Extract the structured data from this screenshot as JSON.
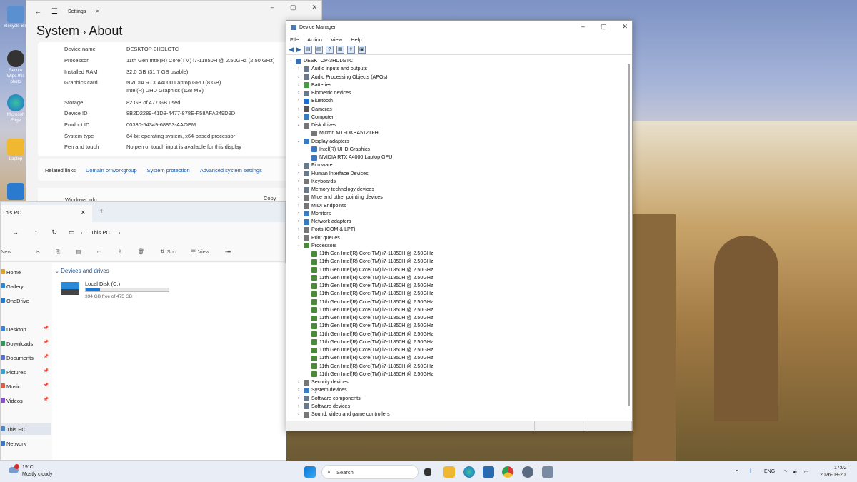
{
  "desktop": {
    "icons": [
      {
        "label": "Recycle Bin",
        "icon": "recycle-bin-icon"
      },
      {
        "label": "Secure Wipe this photo",
        "icon": "secure-wipe-icon"
      },
      {
        "label": "Microsoft Edge",
        "icon": "edge-icon"
      },
      {
        "label": "Laptop",
        "icon": "user-folder-icon"
      },
      {
        "label": "",
        "icon": "monitor-icon"
      }
    ]
  },
  "settings": {
    "title": "Settings",
    "breadcrumb_parent": "System",
    "breadcrumb_sep": "›",
    "breadcrumb_current": "About",
    "specs": [
      {
        "label": "Device name",
        "value": "DESKTOP-3HDLGTC"
      },
      {
        "label": "Processor",
        "value": "11th Gen Intel(R) Core(TM) i7-11850H @ 2.50GHz   (2.50 GHz)"
      },
      {
        "label": "Installed RAM",
        "value": "32.0 GB (31.7 GB usable)"
      },
      {
        "label": "Graphics card",
        "value": "NVIDIA RTX A4000 Laptop GPU (8 GB)"
      },
      {
        "label": "",
        "value": "Intel(R) UHD Graphics (128 MB)"
      },
      {
        "label": "Storage",
        "value": "82 GB of 477 GB used"
      },
      {
        "label": "Device ID",
        "value": "8B2D2289-41D8-4477-878E-F58AFA249D9D"
      },
      {
        "label": "Product ID",
        "value": "00330-54349-68853-AAOEM"
      },
      {
        "label": "System type",
        "value": "64-bit operating system, x64-based processor"
      },
      {
        "label": "Pen and touch",
        "value": "No pen or touch input is available for this display"
      }
    ],
    "related_label": "Related links",
    "related_links": [
      "Domain or workgroup",
      "System protection",
      "Advanced system settings"
    ],
    "windows_info_label": "Windows info",
    "copy_label": "Copy"
  },
  "explorer": {
    "tab_title": "This PC",
    "address": "This PC",
    "cmd": {
      "new": "New",
      "sort": "Sort",
      "view": "View",
      "more": "•••"
    },
    "nav_items": [
      {
        "label": "Home",
        "color": "#e0a030",
        "pinned": false
      },
      {
        "label": "Gallery",
        "color": "#2a8ad8",
        "pinned": false
      },
      {
        "label": "OneDrive",
        "color": "#1e78d2",
        "pinned": false
      },
      {
        "label": "Desktop",
        "color": "#3b82d6",
        "pinned": true
      },
      {
        "label": "Downloads",
        "color": "#2e9a58",
        "pinned": true
      },
      {
        "label": "Documents",
        "color": "#5a6fd0",
        "pinned": true
      },
      {
        "label": "Pictures",
        "color": "#3aa0d8",
        "pinned": true
      },
      {
        "label": "Music",
        "color": "#d8603a",
        "pinned": true
      },
      {
        "label": "Videos",
        "color": "#8a4cd0",
        "pinned": true
      },
      {
        "label": "This PC",
        "color": "#4a86c8",
        "pinned": false
      },
      {
        "label": "Network",
        "color": "#3a7ac0",
        "pinned": false
      }
    ],
    "section_title": "Devices and drives",
    "drive": {
      "name": "Local Disk (C:)",
      "free_text": "394 GB free of 475 GB",
      "used_fraction": 0.17
    }
  },
  "devmgr": {
    "title": "Device Manager",
    "menu": [
      "File",
      "Action",
      "View",
      "Help"
    ],
    "tree": [
      {
        "label": "DESKTOP-3HDLGTC",
        "depth": 0,
        "tw": "v",
        "color": "#3a6fb0"
      },
      {
        "label": "Audio inputs and outputs",
        "depth": 1,
        "tw": ">",
        "color": "#6a7a8a"
      },
      {
        "label": "Audio Processing Objects (APOs)",
        "depth": 1,
        "tw": ">",
        "color": "#6a7a8a"
      },
      {
        "label": "Batteries",
        "depth": 1,
        "tw": ">",
        "color": "#4a9a4a"
      },
      {
        "label": "Biometric devices",
        "depth": 1,
        "tw": ">",
        "color": "#6a7a8a"
      },
      {
        "label": "Bluetooth",
        "depth": 1,
        "tw": ">",
        "color": "#1e6fd0"
      },
      {
        "label": "Cameras",
        "depth": 1,
        "tw": ">",
        "color": "#555"
      },
      {
        "label": "Computer",
        "depth": 1,
        "tw": ">",
        "color": "#3a7ac0"
      },
      {
        "label": "Disk drives",
        "depth": 1,
        "tw": "v",
        "color": "#777"
      },
      {
        "label": "Micron MTFDKBA512TFH",
        "depth": 2,
        "tw": "",
        "color": "#777"
      },
      {
        "label": "Display adapters",
        "depth": 1,
        "tw": "v",
        "color": "#3a7ac0"
      },
      {
        "label": "Intel(R) UHD Graphics",
        "depth": 2,
        "tw": "",
        "color": "#3a7ac0"
      },
      {
        "label": "NVIDIA RTX A4000 Laptop GPU",
        "depth": 2,
        "tw": "",
        "color": "#3a7ac0"
      },
      {
        "label": "Firmware",
        "depth": 1,
        "tw": ">",
        "color": "#6a7a8a"
      },
      {
        "label": "Human Interface Devices",
        "depth": 1,
        "tw": ">",
        "color": "#6a7a8a"
      },
      {
        "label": "Keyboards",
        "depth": 1,
        "tw": ">",
        "color": "#777"
      },
      {
        "label": "Memory technology devices",
        "depth": 1,
        "tw": ">",
        "color": "#6a7a8a"
      },
      {
        "label": "Mice and other pointing devices",
        "depth": 1,
        "tw": ">",
        "color": "#777"
      },
      {
        "label": "MIDI Endpoints",
        "depth": 1,
        "tw": ">",
        "color": "#777"
      },
      {
        "label": "Monitors",
        "depth": 1,
        "tw": ">",
        "color": "#3a7ac0"
      },
      {
        "label": "Network adapters",
        "depth": 1,
        "tw": ">",
        "color": "#3a7ac0"
      },
      {
        "label": "Ports (COM & LPT)",
        "depth": 1,
        "tw": ">",
        "color": "#777"
      },
      {
        "label": "Print queues",
        "depth": 1,
        "tw": ">",
        "color": "#777"
      },
      {
        "label": "Processors",
        "depth": 1,
        "tw": "v",
        "color": "#4a8a3a"
      },
      {
        "label": "11th Gen Intel(R) Core(TM) i7-11850H @ 2.50GHz",
        "depth": 2,
        "tw": "",
        "color": "#4a8a3a"
      },
      {
        "label": "11th Gen Intel(R) Core(TM) i7-11850H @ 2.50GHz",
        "depth": 2,
        "tw": "",
        "color": "#4a8a3a"
      },
      {
        "label": "11th Gen Intel(R) Core(TM) i7-11850H @ 2.50GHz",
        "depth": 2,
        "tw": "",
        "color": "#4a8a3a"
      },
      {
        "label": "11th Gen Intel(R) Core(TM) i7-11850H @ 2.50GHz",
        "depth": 2,
        "tw": "",
        "color": "#4a8a3a"
      },
      {
        "label": "11th Gen Intel(R) Core(TM) i7-11850H @ 2.50GHz",
        "depth": 2,
        "tw": "",
        "color": "#4a8a3a"
      },
      {
        "label": "11th Gen Intel(R) Core(TM) i7-11850H @ 2.50GHz",
        "depth": 2,
        "tw": "",
        "color": "#4a8a3a"
      },
      {
        "label": "11th Gen Intel(R) Core(TM) i7-11850H @ 2.50GHz",
        "depth": 2,
        "tw": "",
        "color": "#4a8a3a"
      },
      {
        "label": "11th Gen Intel(R) Core(TM) i7-11850H @ 2.50GHz",
        "depth": 2,
        "tw": "",
        "color": "#4a8a3a"
      },
      {
        "label": "11th Gen Intel(R) Core(TM) i7-11850H @ 2.50GHz",
        "depth": 2,
        "tw": "",
        "color": "#4a8a3a"
      },
      {
        "label": "11th Gen Intel(R) Core(TM) i7-11850H @ 2.50GHz",
        "depth": 2,
        "tw": "",
        "color": "#4a8a3a"
      },
      {
        "label": "11th Gen Intel(R) Core(TM) i7-11850H @ 2.50GHz",
        "depth": 2,
        "tw": "",
        "color": "#4a8a3a"
      },
      {
        "label": "11th Gen Intel(R) Core(TM) i7-11850H @ 2.50GHz",
        "depth": 2,
        "tw": "",
        "color": "#4a8a3a"
      },
      {
        "label": "11th Gen Intel(R) Core(TM) i7-11850H @ 2.50GHz",
        "depth": 2,
        "tw": "",
        "color": "#4a8a3a"
      },
      {
        "label": "11th Gen Intel(R) Core(TM) i7-11850H @ 2.50GHz",
        "depth": 2,
        "tw": "",
        "color": "#4a8a3a"
      },
      {
        "label": "11th Gen Intel(R) Core(TM) i7-11850H @ 2.50GHz",
        "depth": 2,
        "tw": "",
        "color": "#4a8a3a"
      },
      {
        "label": "11th Gen Intel(R) Core(TM) i7-11850H @ 2.50GHz",
        "depth": 2,
        "tw": "",
        "color": "#4a8a3a"
      },
      {
        "label": "Security devices",
        "depth": 1,
        "tw": ">",
        "color": "#777"
      },
      {
        "label": "System devices",
        "depth": 1,
        "tw": ">",
        "color": "#3a7ac0"
      },
      {
        "label": "Software components",
        "depth": 1,
        "tw": ">",
        "color": "#6a7a8a"
      },
      {
        "label": "Software devices",
        "depth": 1,
        "tw": ">",
        "color": "#6a7a8a"
      },
      {
        "label": "Sound, video and game controllers",
        "depth": 1,
        "tw": ">",
        "color": "#777"
      }
    ]
  },
  "taskbar": {
    "weather_temp": "19°C",
    "weather_desc": "Mostly cloudy",
    "search_placeholder": "Search",
    "lang": "ENG",
    "time": "17:02",
    "date": "2026-08-20",
    "apps": [
      "start-icon",
      "task-view-icon",
      "file-explorer-icon",
      "edge-icon",
      "store-icon",
      "chrome-icon",
      "settings-icon",
      "device-manager-icon"
    ]
  }
}
